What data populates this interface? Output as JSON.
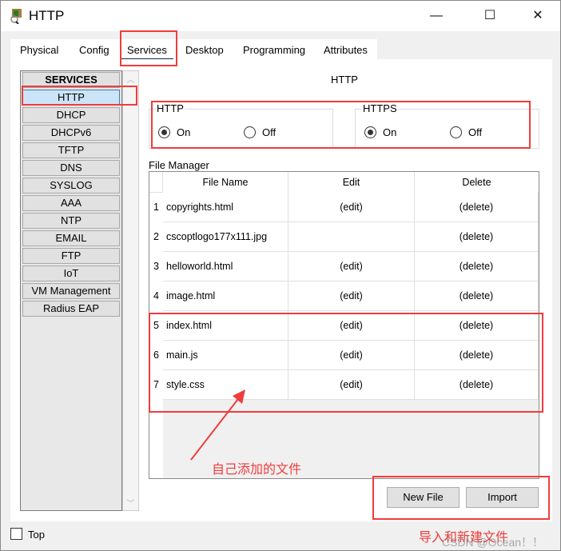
{
  "window": {
    "title": "HTTP",
    "minimize": "—",
    "maximize": "☐",
    "close": "✕"
  },
  "tabs": [
    {
      "label": "Physical"
    },
    {
      "label": "Config"
    },
    {
      "label": "Services",
      "active": true
    },
    {
      "label": "Desktop"
    },
    {
      "label": "Programming"
    },
    {
      "label": "Attributes"
    }
  ],
  "sidebar": {
    "header": "SERVICES",
    "items": [
      "HTTP",
      "DHCP",
      "DHCPv6",
      "TFTP",
      "DNS",
      "SYSLOG",
      "AAA",
      "NTP",
      "EMAIL",
      "FTP",
      "IoT",
      "VM Management",
      "Radius EAP"
    ],
    "selected": "HTTP"
  },
  "main": {
    "title": "HTTP",
    "http": {
      "label": "HTTP",
      "on": "On",
      "off": "Off",
      "value": "On"
    },
    "https": {
      "label": "HTTPS",
      "on": "On",
      "off": "Off",
      "value": "On"
    },
    "file_manager": {
      "label": "File Manager",
      "columns": [
        "File Name",
        "Edit",
        "Delete"
      ],
      "rows": [
        {
          "n": "1",
          "name": "copyrights.html",
          "edit": "(edit)",
          "delete": "(delete)"
        },
        {
          "n": "2",
          "name": "cscoptlogo177x111.jpg",
          "edit": "",
          "delete": "(delete)"
        },
        {
          "n": "3",
          "name": "helloworld.html",
          "edit": "(edit)",
          "delete": "(delete)"
        },
        {
          "n": "4",
          "name": "image.html",
          "edit": "(edit)",
          "delete": "(delete)"
        },
        {
          "n": "5",
          "name": "index.html",
          "edit": "(edit)",
          "delete": "(delete)"
        },
        {
          "n": "6",
          "name": "main.js",
          "edit": "(edit)",
          "delete": "(delete)"
        },
        {
          "n": "7",
          "name": "style.css",
          "edit": "(edit)",
          "delete": "(delete)"
        }
      ]
    },
    "new_file": "New File",
    "import": "Import"
  },
  "footer": {
    "top_label": "Top",
    "top_checked": false
  },
  "annotations": {
    "added_files": "自己添加的文件",
    "import_new": "导入和新建文件",
    "watermark": "CSDN @Ocean！！",
    "color": "#f03c3c"
  }
}
